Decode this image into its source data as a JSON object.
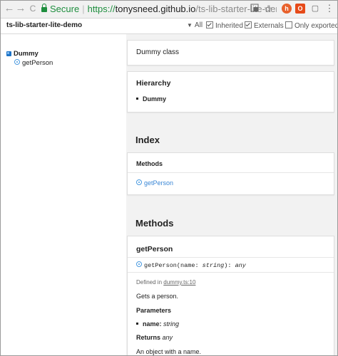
{
  "browser": {
    "secure_label": "Secure",
    "url_proto": "https://",
    "url_host": "tonysneed.github.io",
    "url_path": "/ts-lib-starter-lite-demo",
    "back_icon": "←",
    "forward_icon": "→",
    "reload_icon": "C"
  },
  "header": {
    "site_title": "ts-lib-starter-lite-demo",
    "filter_all": "All",
    "filter_inherited": "Inherited",
    "filter_externals": "Externals",
    "filter_only_exported": "Only exported"
  },
  "sidebar": {
    "class_label": "Dummy",
    "method_label": "getPerson"
  },
  "main": {
    "description": "Dummy class",
    "hierarchy_title": "Hierarchy",
    "hierarchy_item": "Dummy",
    "index_heading": "Index",
    "methods_group_title": "Methods",
    "index_method_link": "getPerson",
    "methods_heading": "Methods",
    "member_title": "getPerson",
    "signature": {
      "name": "getPerson",
      "open": "(",
      "param": "name",
      "colon": ": ",
      "param_type": "string",
      "close": "): ",
      "return_type": "any"
    },
    "defined_in_label": "Defined in ",
    "defined_in_link": "dummy.ts:10",
    "summary": "Gets a person.",
    "parameters_title": "Parameters",
    "param_name": "name:",
    "param_type": "string",
    "returns_label": "Returns",
    "returns_type": "any",
    "returns_desc": "An object with a name."
  }
}
